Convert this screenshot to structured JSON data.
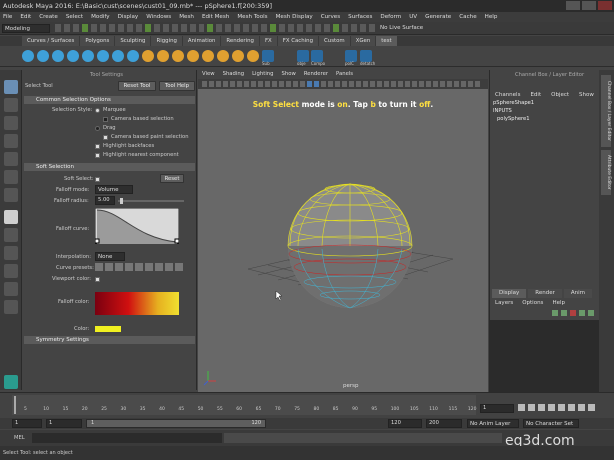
{
  "window": {
    "title": "Autodesk Maya 2016: E:\\Basic\\cust\\scenes\\cust01_09.mb*  ---  pSphere1.f[200:359]"
  },
  "menubar": [
    "File",
    "Edit",
    "Create",
    "Select",
    "Modify",
    "Display",
    "Windows",
    "Mesh",
    "Edit Mesh",
    "Mesh Tools",
    "Mesh Display",
    "Curves",
    "Surfaces",
    "Deform",
    "UV",
    "Generate",
    "Cache",
    "Help"
  ],
  "statusline": {
    "menuset": "Modeling",
    "live_surface": "No Live Surface"
  },
  "shelf": {
    "tabs": [
      "Curves / Surfaces",
      "Polygons",
      "Sculpting",
      "Rigging",
      "Animation",
      "Rendering",
      "FX",
      "FX Caching",
      "Custom",
      "XGen",
      "test"
    ],
    "active": "test",
    "icon_labels": [
      "Sub",
      "obje",
      "Compo",
      "polC",
      "detatch"
    ]
  },
  "tool_settings": {
    "panel_title": "Tool Settings",
    "tool_name": "Select Tool",
    "reset_button": "Reset Tool",
    "help_button": "Tool Help",
    "common_header": "Common Selection Options",
    "selection_style_label": "Selection Style:",
    "marquee": "Marquee",
    "camera_marquee": "Camera based selection",
    "drag": "Drag",
    "camera_paint": "Camera based paint selection",
    "highlight_backfaces": "Highlight backfaces",
    "highlight_nearest": "Highlight nearest component",
    "soft_header": "Soft Selection",
    "soft_select_label": "Soft Select:",
    "reset_button2": "Reset",
    "falloff_mode_label": "Falloff mode:",
    "falloff_mode_value": "Volume",
    "falloff_radius_label": "Falloff radius:",
    "falloff_radius_value": "5.00",
    "falloff_curve_label": "Falloff curve:",
    "interpolation_label": "Interpolation:",
    "interpolation_value": "None",
    "curve_presets_label": "Curve presets:",
    "viewport_color_label": "Viewport color:",
    "falloff_color_label": "Falloff color:",
    "color_label": "Color:",
    "symmetry_header": "Symmetry Settings"
  },
  "viewport": {
    "menus": [
      "View",
      "Shading",
      "Lighting",
      "Show",
      "Renderer",
      "Panels"
    ],
    "hint_pre": "Soft Select",
    "hint_mid": " mode is ",
    "hint_on": "on",
    "hint_mid2": ". Tap ",
    "hint_key": "b",
    "hint_mid3": " to turn it ",
    "hint_off": "off",
    "hint_end": ".",
    "camera": "persp"
  },
  "channel_box": {
    "title": "Channel Box / Layer Editor",
    "menus": [
      "Channels",
      "Edit",
      "Object",
      "Show"
    ],
    "items": [
      "pSphereShape1",
      "INPUTS",
      "polySphere1"
    ]
  },
  "layer_editor": {
    "tabs": [
      "Display",
      "Render",
      "Anim"
    ],
    "menus": [
      "Layers",
      "Options",
      "Help"
    ]
  },
  "side_tabs": [
    "Channel Box / Layer Editor",
    "Attribute Editor"
  ],
  "timeline": {
    "ticks": [
      "5",
      "10",
      "15",
      "20",
      "25",
      "30",
      "35",
      "40",
      "45",
      "50",
      "55",
      "60",
      "65",
      "70",
      "75",
      "80",
      "85",
      "90",
      "95",
      "100",
      "105",
      "110",
      "115",
      "120"
    ],
    "current": "1"
  },
  "range": {
    "start": "1",
    "start2": "1",
    "inner_start": "1",
    "inner_end": "120",
    "end": "120",
    "end2": "200",
    "anim_layer": "No Anim Layer",
    "char_set": "No Character Set"
  },
  "cmdline": {
    "label": "MEL"
  },
  "helpline": {
    "text": "Select Tool: select an object"
  },
  "watermark": "eq3d.com"
}
